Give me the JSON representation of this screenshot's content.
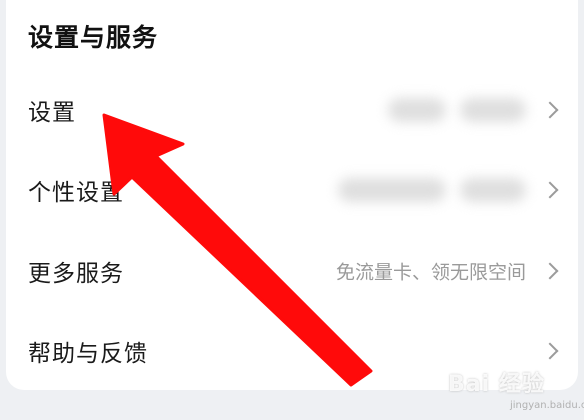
{
  "section": {
    "title": "设置与服务"
  },
  "rows": [
    {
      "label": "设置",
      "value": ""
    },
    {
      "label": "个性设置",
      "value": ""
    },
    {
      "label": "更多服务",
      "value": "免流量卡、领无限空间"
    },
    {
      "label": "帮助与反馈",
      "value": ""
    }
  ],
  "watermark": {
    "brand": "Bai 经验",
    "site": "jingyan.baidu.com"
  },
  "colors": {
    "background": "#eef0f3",
    "card": "#ffffff",
    "arrow": "#ff0a0a",
    "secondary_text": "#9a9a9a"
  }
}
